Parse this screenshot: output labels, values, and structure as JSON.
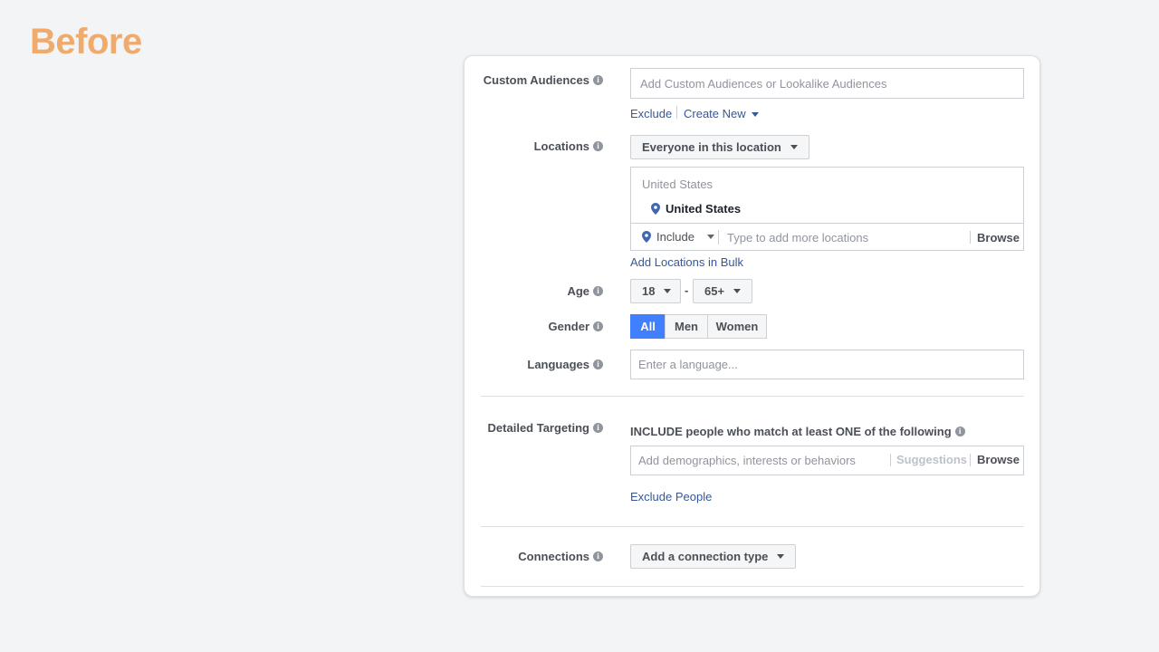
{
  "page": {
    "heading": "Before"
  },
  "custom_audiences": {
    "label": "Custom Audiences",
    "placeholder": "Add Custom Audiences or Lookalike Audiences",
    "exclude_link": "Exclude",
    "create_new_link": "Create New"
  },
  "locations": {
    "label": "Locations",
    "dropdown": "Everyone in this location",
    "country_header": "United States",
    "selected_location": "United States",
    "include_select": "Include",
    "search_placeholder": "Type to add more locations",
    "browse": "Browse",
    "bulk_link": "Add Locations in Bulk"
  },
  "age": {
    "label": "Age",
    "min": "18",
    "separator": "-",
    "max": "65+"
  },
  "gender": {
    "label": "Gender",
    "options": [
      "All",
      "Men",
      "Women"
    ],
    "selected": "All"
  },
  "languages": {
    "label": "Languages",
    "placeholder": "Enter a language..."
  },
  "detailed_targeting": {
    "label": "Detailed Targeting",
    "instruction": "INCLUDE people who match at least ONE of the following",
    "placeholder": "Add demographics, interests or behaviors",
    "suggestions": "Suggestions",
    "browse": "Browse",
    "exclude_link": "Exclude People"
  },
  "connections": {
    "label": "Connections",
    "dropdown": "Add a connection type"
  },
  "colors": {
    "heading": "#efaa6c",
    "link": "#365899",
    "accent": "#4080ff"
  }
}
